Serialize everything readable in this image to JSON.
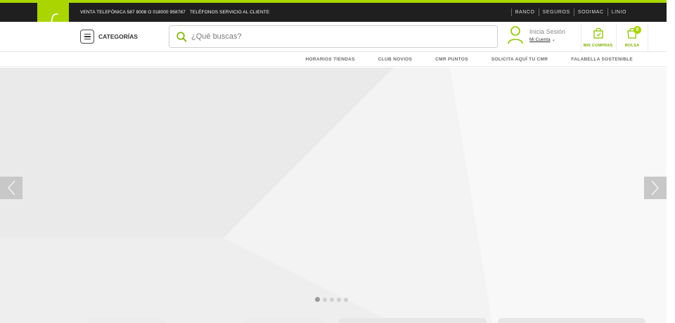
{
  "colors": {
    "brand": "#aad500",
    "topbar_bg": "#1f1f1f",
    "hero_bg": "#efefef"
  },
  "topbar": {
    "phone_sales": "VENTA TELEFÓNICA 587 8008 O 018000 958787",
    "customer_service": "TELÉFONOS SERVICIO AL CLIENTE",
    "links": [
      "BANCO",
      "SEGUROS",
      "SODIMAC",
      "LINIO"
    ]
  },
  "logo": {
    "icon": "falabella-f-logo"
  },
  "header": {
    "categories_label": "CATEGORÍAS",
    "search_placeholder": "¿Qué buscas?",
    "account": {
      "line1": "Inicia Sesión",
      "line2": "Mi Cuenta",
      "icon": "user-icon"
    },
    "my_purchases": {
      "label": "MIS COMPRAS",
      "icon": "shopping-bag-icon"
    },
    "cart": {
      "label": "BOLSA",
      "count": "0",
      "icon": "cart-bag-icon"
    }
  },
  "subnav": {
    "links": [
      "HORARIOS TIENDAS",
      "CLUB NOVIOS",
      "CMR PUNTOS",
      "SOLICITA AQUÍ TU CMR",
      "FALABELLA SOSTENIBLE"
    ]
  },
  "carousel": {
    "slide_count": 5,
    "active_index": 0
  }
}
